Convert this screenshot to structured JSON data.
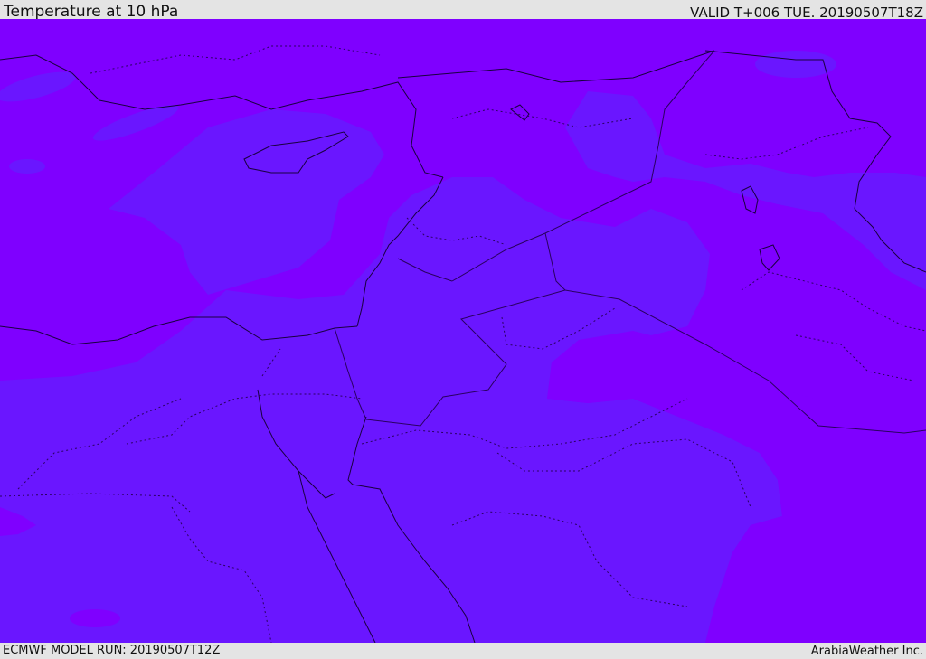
{
  "header": {
    "title": "Temperature at 10 hPa",
    "valid": "VALID T+006 TUE. 20190507T18Z"
  },
  "footer": {
    "model_run": "ECMWF MODEL RUN: 20190507T12Z",
    "credit": "ArabiaWeather Inc."
  },
  "map": {
    "field": "temperature",
    "level": "10 hPa",
    "colors": {
      "background_band": "#7f00ff",
      "cooler_band": "#6a16ff",
      "light_band": "#7a20ff",
      "coast_line": "#1a0040",
      "border_line": "#2a0060"
    }
  }
}
